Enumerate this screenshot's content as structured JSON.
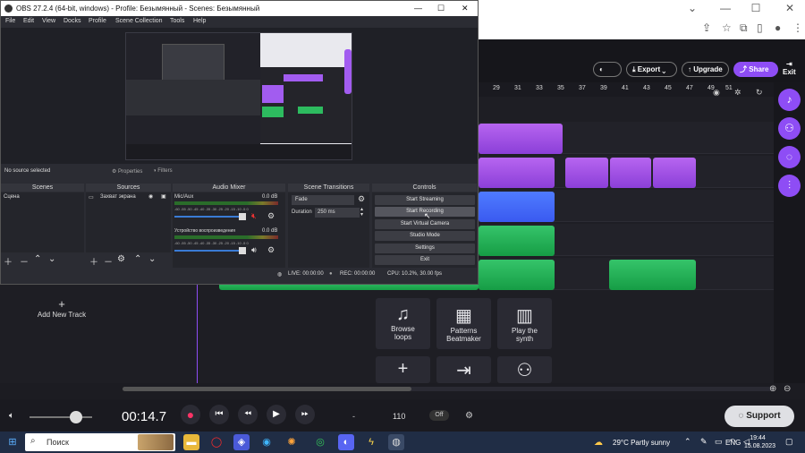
{
  "obs": {
    "title": "OBS 27.2.4 (64-bit, windows) - Profile: Безымянный - Scenes: Безымянный",
    "menu": [
      "File",
      "Edit",
      "View",
      "Docks",
      "Profile",
      "Scene Collection",
      "Tools",
      "Help"
    ],
    "no_source": "No source selected",
    "properties": "Properties",
    "filters": "Filters",
    "docks": {
      "scenes": "Scenes",
      "sources": "Sources",
      "audio_mixer": "Audio Mixer",
      "scene_transitions": "Scene Transitions",
      "controls": "Controls"
    },
    "scene_item": "Сцена",
    "source_item": "Захват экрана",
    "mixer": [
      {
        "name": "Mic/Aux",
        "db": "0.0 dB"
      },
      {
        "name": "Устройство воспроизведения",
        "db": "0.0 dB"
      }
    ],
    "meter_ticks": "-60 -55 -50 -45 -40 -35 -30 -25 -20 -15 -10 -5 0",
    "transition": "Fade",
    "duration_label": "Duration",
    "duration_value": "250 ms",
    "controls": [
      "Start Streaming",
      "Start Recording",
      "Start Virtual Camera",
      "Studio Mode",
      "Settings",
      "Exit"
    ],
    "status": {
      "live": "LIVE: 00:00:00",
      "rec": "REC: 00:00:00",
      "cpu": "CPU: 10.2%, 30.00 fps"
    }
  },
  "bandlab": {
    "export": "Export",
    "upgrade": "Upgrade",
    "share": "Share",
    "exit": "Exit",
    "ruler": [
      "29",
      "31",
      "33",
      "35",
      "37",
      "39",
      "41",
      "43",
      "45",
      "47",
      "49",
      "51"
    ],
    "add_track": "Add New Track",
    "tiles": [
      {
        "l1": "Browse",
        "l2": "loops"
      },
      {
        "l1": "Patterns",
        "l2": "Beatmaker"
      },
      {
        "l1": "Play the",
        "l2": "synth"
      }
    ],
    "time": "00:14.7",
    "tempo_dash": "-",
    "bpm": "110",
    "off": "Off",
    "support": "Support"
  },
  "taskbar": {
    "search": "Поиск",
    "weather": "29°C  Partly sunny",
    "lang": "ENG",
    "time": "19:44",
    "date": "15.08.2023"
  },
  "colors": {
    "purple": "#8e4df5",
    "obs_bg": "#2b2c33",
    "taskbar": "#202d45"
  }
}
